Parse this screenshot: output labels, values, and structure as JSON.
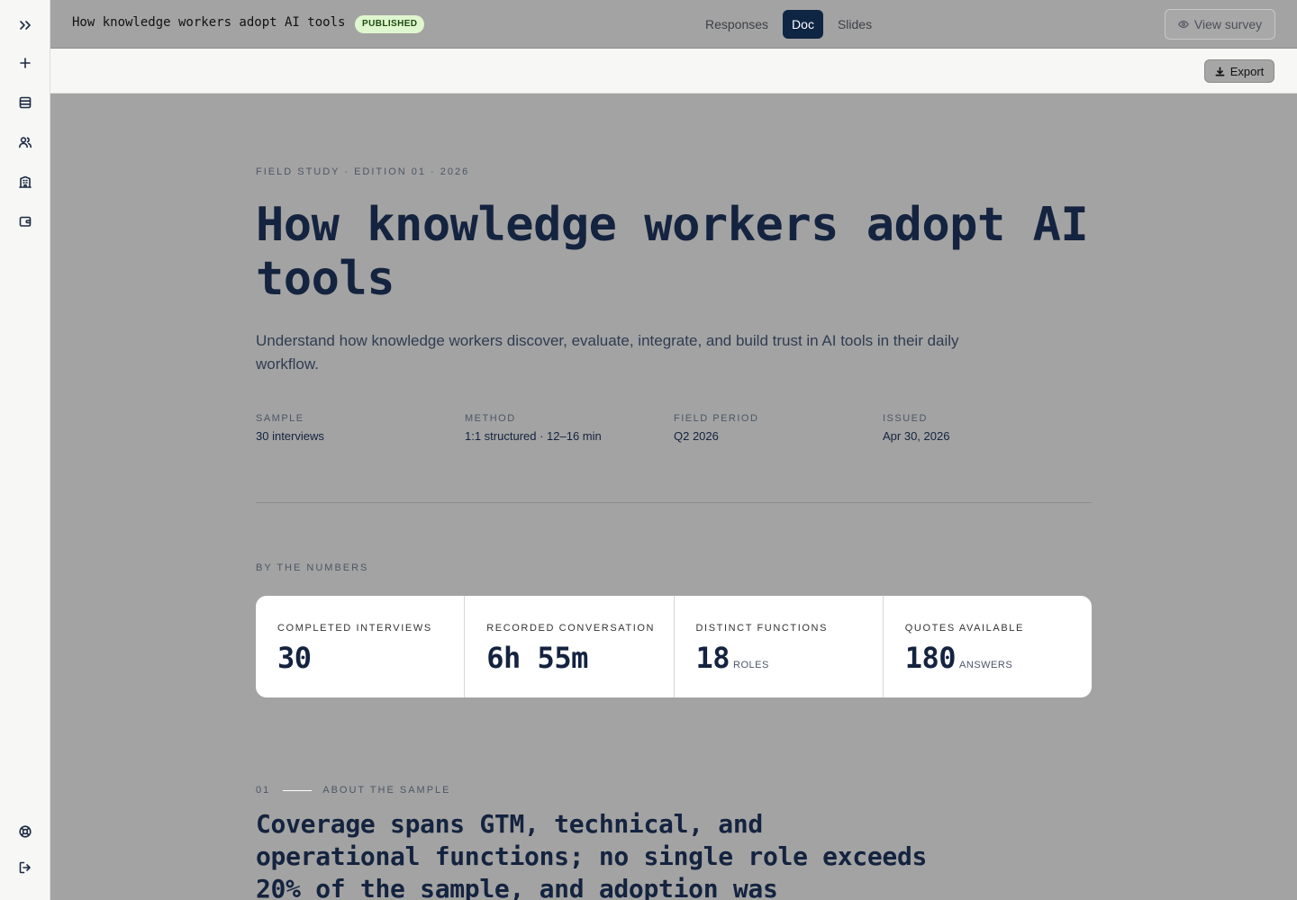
{
  "header": {
    "title": "How knowledge workers adopt AI tools",
    "status_badge": "PUBLISHED",
    "tabs": [
      {
        "label": "Responses",
        "active": false
      },
      {
        "label": "Doc",
        "active": true
      },
      {
        "label": "Slides",
        "active": false
      }
    ],
    "view_survey_label": "View survey"
  },
  "toolbar": {
    "export_label": "Export"
  },
  "sidebar": {
    "top_icons": [
      "expand-icon",
      "plus-icon",
      "table-icon",
      "users-icon",
      "building-icon",
      "wallet-icon"
    ],
    "bottom_icons": [
      "help-icon",
      "logout-icon"
    ]
  },
  "doc": {
    "eyebrow": "FIELD STUDY · EDITION 01 · 2026",
    "title": "How knowledge workers adopt AI tools",
    "subtitle": "Understand how knowledge workers discover, evaluate, integrate, and build trust in AI tools in their daily workflow.",
    "meta": [
      {
        "label": "SAMPLE",
        "value": "30 interviews"
      },
      {
        "label": "METHOD",
        "value": "1:1 structured · 12–16 min"
      },
      {
        "label": "FIELD PERIOD",
        "value": "Q2 2026"
      },
      {
        "label": "ISSUED",
        "value": "Apr 30, 2026"
      }
    ],
    "numbers_heading": "BY THE NUMBERS",
    "stats": [
      {
        "label": "COMPLETED INTERVIEWS",
        "value": "30",
        "unit": ""
      },
      {
        "label": "RECORDED CONVERSATION",
        "value": "6h 55m",
        "unit": ""
      },
      {
        "label": "DISTINCT FUNCTIONS",
        "value": "18",
        "unit": "ROLES"
      },
      {
        "label": "QUOTES AVAILABLE",
        "value": "180",
        "unit": "ANSWERS"
      }
    ],
    "section": {
      "number": "01",
      "label": "ABOUT THE SAMPLE",
      "title": "Coverage spans GTM, technical, and operational functions; no single role exceeds 20% of the sample, and adoption was"
    }
  },
  "colors": {
    "navy": "#14233f",
    "active_tab": "#0f2544",
    "badge_bg": "#dff7cf",
    "overlay_gray": "#a3a3a3"
  }
}
